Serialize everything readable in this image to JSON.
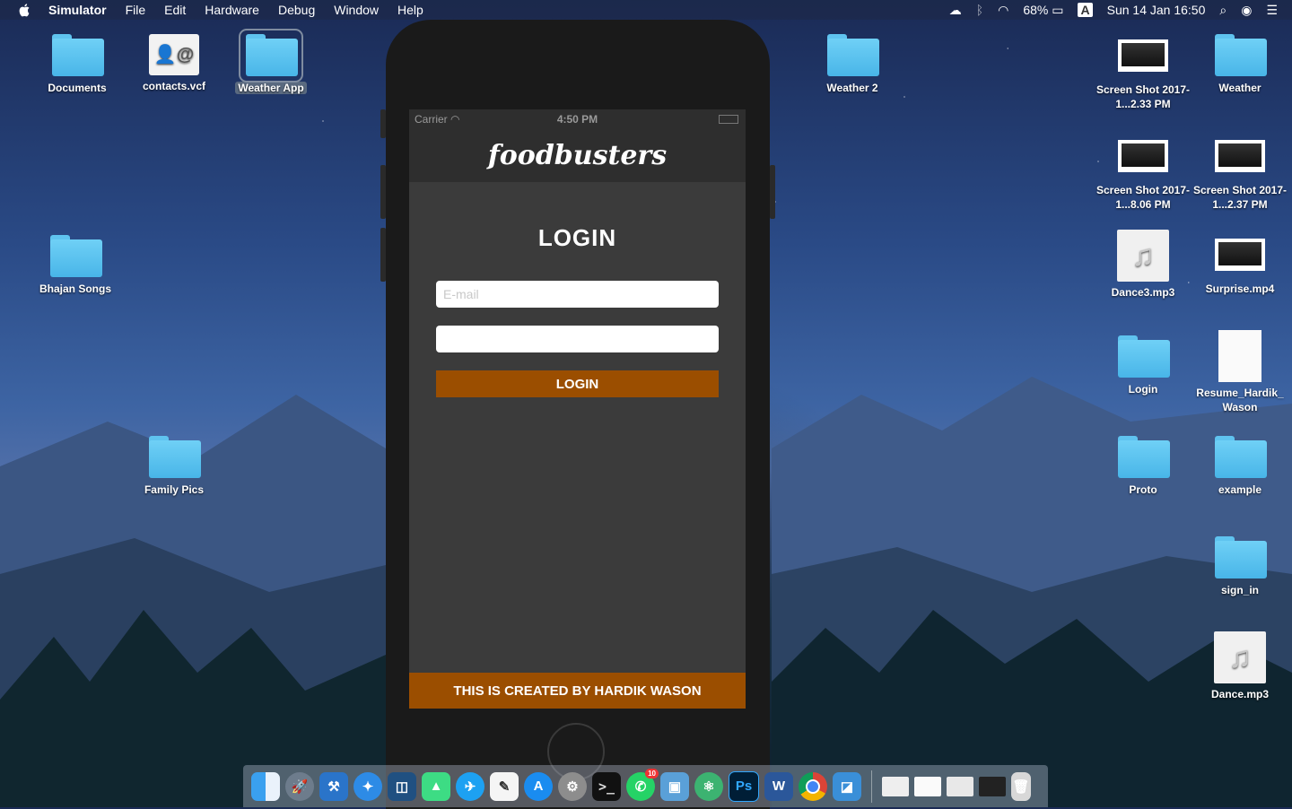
{
  "menubar": {
    "app_name": "Simulator",
    "items": [
      "File",
      "Edit",
      "Hardware",
      "Debug",
      "Window",
      "Help"
    ],
    "battery": "68%",
    "input_source": "A",
    "datetime": "Sun 14 Jan  16:50"
  },
  "desktop": {
    "icons": [
      {
        "label": "Documents",
        "kind": "folder"
      },
      {
        "label": "contacts.vcf",
        "kind": "vcf"
      },
      {
        "label": "Weather App",
        "kind": "folder",
        "selected": true
      },
      {
        "label": "Weather 2",
        "kind": "folder"
      },
      {
        "label": "Screen Shot 2017-1...2.33 PM",
        "kind": "screenshot"
      },
      {
        "label": "Weather",
        "kind": "folder"
      },
      {
        "label": "Screen Shot 2017-1...8.06 PM",
        "kind": "screenshot"
      },
      {
        "label": "Screen Shot 2017-1...2.37 PM",
        "kind": "screenshot"
      },
      {
        "label": "Bhajan Songs",
        "kind": "folder"
      },
      {
        "label": "Dance3.mp3",
        "kind": "music"
      },
      {
        "label": "Surprise.mp4",
        "kind": "video"
      },
      {
        "label": "Login",
        "kind": "folder"
      },
      {
        "label": "Resume_Hardik_Wason",
        "kind": "document"
      },
      {
        "label": "Family Pics",
        "kind": "folder"
      },
      {
        "label": "Proto",
        "kind": "folder"
      },
      {
        "label": "example",
        "kind": "folder"
      },
      {
        "label": "sign_in",
        "kind": "folder"
      },
      {
        "label": "Dance.mp3",
        "kind": "music"
      }
    ]
  },
  "simulator": {
    "statusbar": {
      "carrier": "Carrier",
      "time": "4:50 PM"
    },
    "brand": "foodbusters",
    "title": "LOGIN",
    "email_placeholder": "E-mail",
    "password_value": "",
    "login_button": "LOGIN",
    "footer": "THIS IS CREATED BY HARDIK WASON",
    "accent_color": "#9b4e00"
  },
  "dock": {
    "apps": [
      "finder-icon",
      "launchpad-icon",
      "xcode-icon",
      "safari-icon",
      "sourcetree-icon",
      "android-studio-icon",
      "twitter-icon",
      "textedit-icon",
      "app-store-icon",
      "system-preferences-icon",
      "terminal-icon",
      "whatsapp-icon",
      "preview-icon",
      "atom-icon",
      "photoshop-icon",
      "word-icon",
      "chrome-icon",
      "simulator-icon"
    ],
    "whatsapp_badge": "10"
  }
}
